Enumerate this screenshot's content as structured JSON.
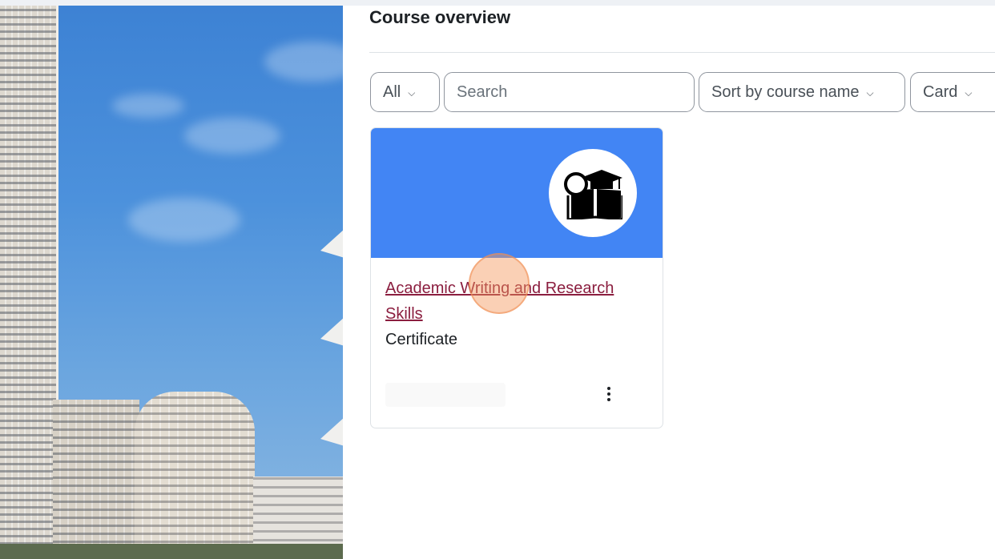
{
  "page": {
    "heading": "Course overview"
  },
  "filters": {
    "grouping": {
      "selected": "All",
      "icon": "chevron-down-icon"
    },
    "search": {
      "placeholder": "Search",
      "value": ""
    },
    "sort": {
      "selected": "Sort by course name",
      "icon": "chevron-down-icon"
    },
    "view": {
      "selected": "Card",
      "icon": "chevron-down-icon"
    }
  },
  "courses": [
    {
      "name": "Academic Writing and Research Skills",
      "category": "Certificate",
      "banner_color": "#4285f4",
      "logo_icon": "graduation-book-search-icon",
      "menu_icon": "vertical-dots-icon"
    }
  ],
  "colors": {
    "link": "#8b1e3f",
    "text": "#1d2125",
    "border": "#8f959e",
    "click_marker": "#f5965a"
  }
}
